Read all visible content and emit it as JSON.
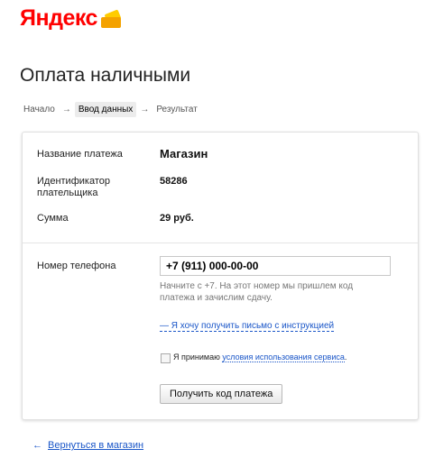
{
  "brand": {
    "logo_text": "Яндекс",
    "logo_color": "#ff0000"
  },
  "page": {
    "title": "Оплата наличными"
  },
  "steps": [
    {
      "label": "Начало",
      "active": false
    },
    {
      "label": "Ввод данных",
      "active": true
    },
    {
      "label": "Результат",
      "active": false
    }
  ],
  "step_arrow": "→",
  "payment": {
    "name_label": "Название платежа",
    "name_value": "Магазин",
    "payer_id_label": "Идентификатор плательщика",
    "payer_id_value": "58286",
    "amount_label": "Сумма",
    "amount_value": "29 руб."
  },
  "phone": {
    "label": "Номер телефона",
    "value": "+7 (911) 000-00-00",
    "hint": "Начните с +7. На этот номер мы пришлем код платежа и зачислим сдачу.",
    "mail_link": "— Я хочу получить письмо с инструкцией"
  },
  "agreement": {
    "checked": false,
    "text": "Я принимаю",
    "link": "условия использования сервиса",
    "suffix": "."
  },
  "submit_label": "Получить код платежа",
  "back": {
    "arrow": "←",
    "label": "Вернуться в магазин"
  },
  "colors": {
    "link": "#1a56c8",
    "active_step_bg": "#ececec"
  }
}
